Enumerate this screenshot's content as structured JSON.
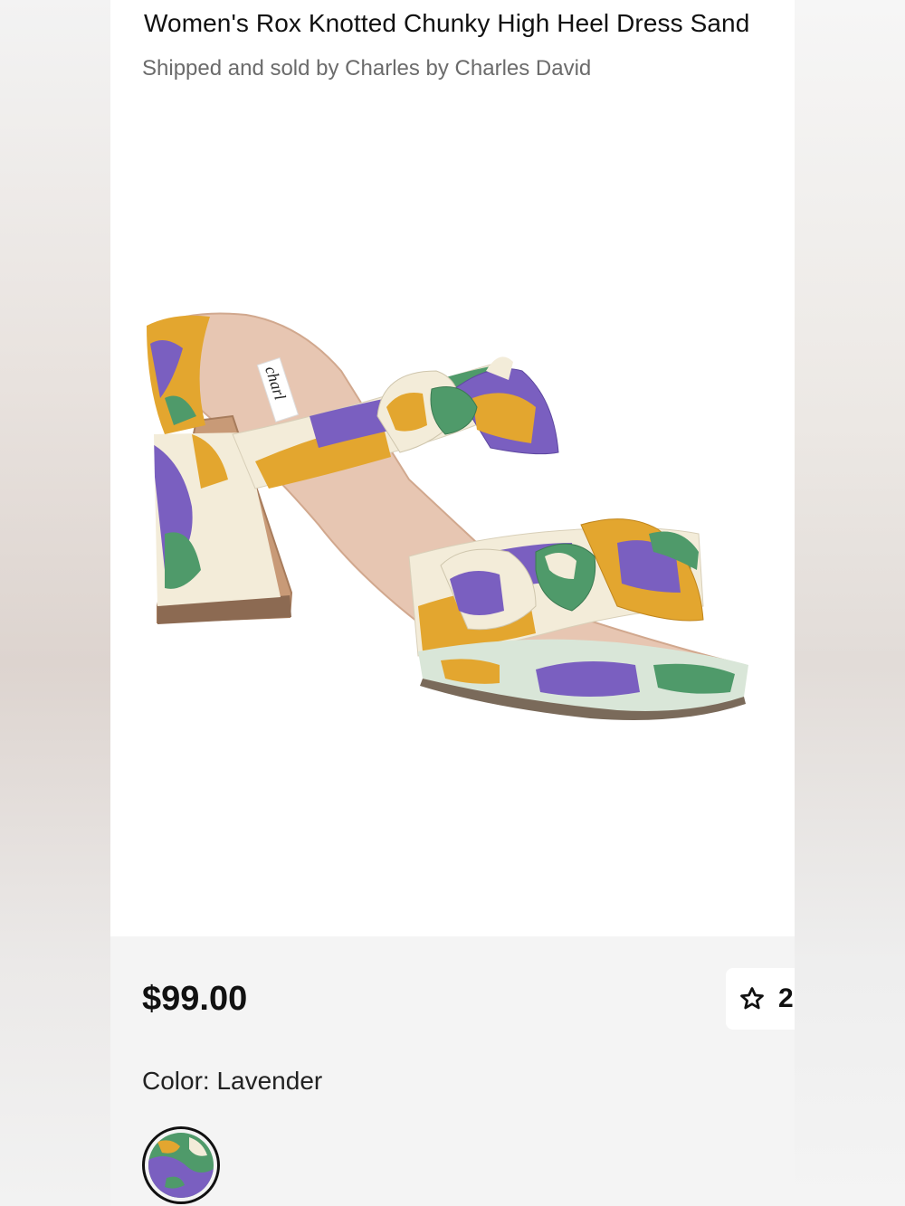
{
  "product": {
    "title": "Women's Rox Knotted Chunky High Heel Dress Sand",
    "seller_line": "Shipped and sold by Charles by Charles David",
    "image_brand_text": "charl"
  },
  "pricing": {
    "price": "$99.00",
    "favorite_count": "2",
    "favorite_icon": "star-outline-icon"
  },
  "color": {
    "label": "Color: Lavender",
    "swatch_name": "Lavender"
  },
  "colors": {
    "purple": "#7a5fc0",
    "mustard": "#e3a62f",
    "green": "#4f9a6a",
    "cream": "#f3ecd9",
    "heel_tan": "#c89a77",
    "insole": "#e7c6b2"
  }
}
